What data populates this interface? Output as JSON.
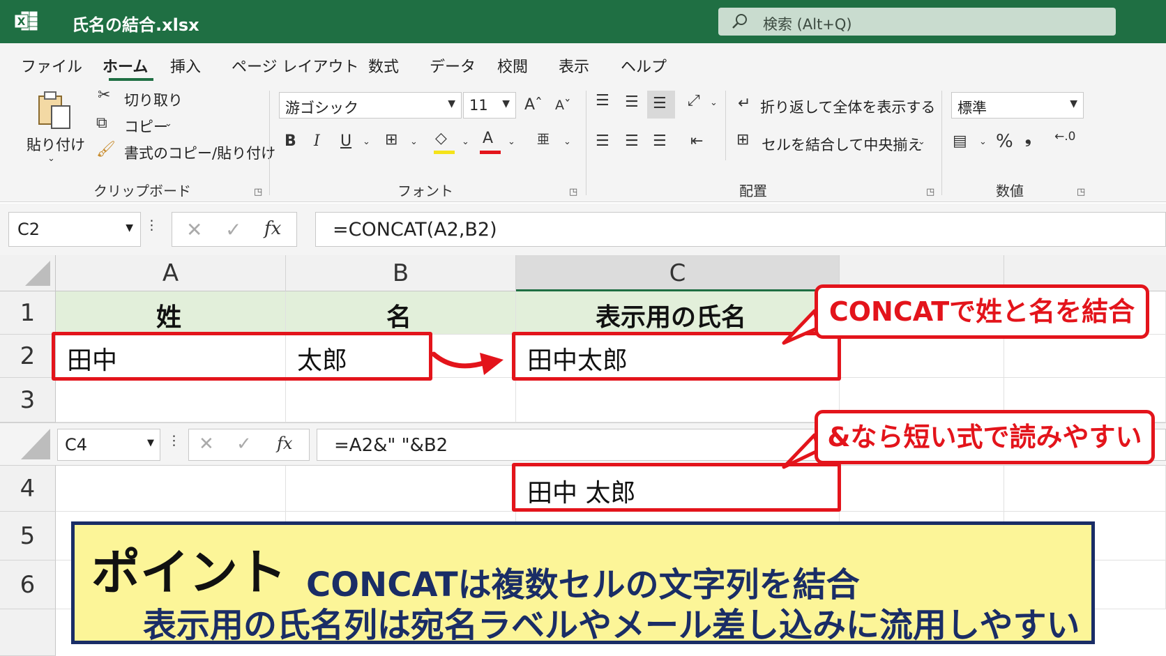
{
  "app": {
    "title": "氏名の結合.xlsx"
  },
  "search": {
    "placeholder": "検索 (Alt+Q)"
  },
  "tabs": [
    "ファイル",
    "ホーム",
    "挿入",
    "ページ レイアウト",
    "数式",
    "データ",
    "校閲",
    "表示",
    "ヘルプ"
  ],
  "ribbon": {
    "clipboard": {
      "paste": "貼り付け",
      "cut": "切り取り",
      "copy": "コピー",
      "format_painter": "書式のコピー/貼り付け",
      "label": "クリップボード"
    },
    "font": {
      "family": "游ゴシック",
      "size": "11",
      "label": "フォント",
      "bold": "B",
      "italic": "I",
      "underline": "U"
    },
    "alignment": {
      "wrap": "折り返して全体を表示する",
      "merge": "セルを結合して中央揃え",
      "label": "配置"
    },
    "number": {
      "format": "標準",
      "percent": "%",
      "label": "数値"
    }
  },
  "formula_bar": {
    "name_box": "C2",
    "formula": "=CONCAT(A2,B2)",
    "fx": "fx"
  },
  "inset_formula_bar": {
    "name_box": "C4",
    "formula": "=A2&\" \"&B2",
    "fx": "fx"
  },
  "grid": {
    "columns": [
      "A",
      "B",
      "C"
    ],
    "rows": [
      "1",
      "2",
      "3",
      "4",
      "5",
      "6"
    ],
    "cells": {
      "A1": "姓",
      "B1": "名",
      "C1": "表示用の氏名",
      "A2": "田中",
      "B2": "太郎",
      "C2": "田中太郎",
      "C4": "田中 太郎"
    }
  },
  "callouts": {
    "concat": "CONCATで姓と名を結合",
    "ampersand": "&なら短い式で読みやすい"
  },
  "point": {
    "title": "ポイント",
    "line1": "CONCATは複数セルの文字列を結合",
    "line2": "表示用の氏名列は宛名ラベルやメール差し込みに流用しやすい"
  },
  "colors": {
    "excel_green": "#1f6f43",
    "callout_red": "#e3141b",
    "point_bg": "#fcf598",
    "point_border": "#1a2d66",
    "header_fill": "#e2efda"
  }
}
